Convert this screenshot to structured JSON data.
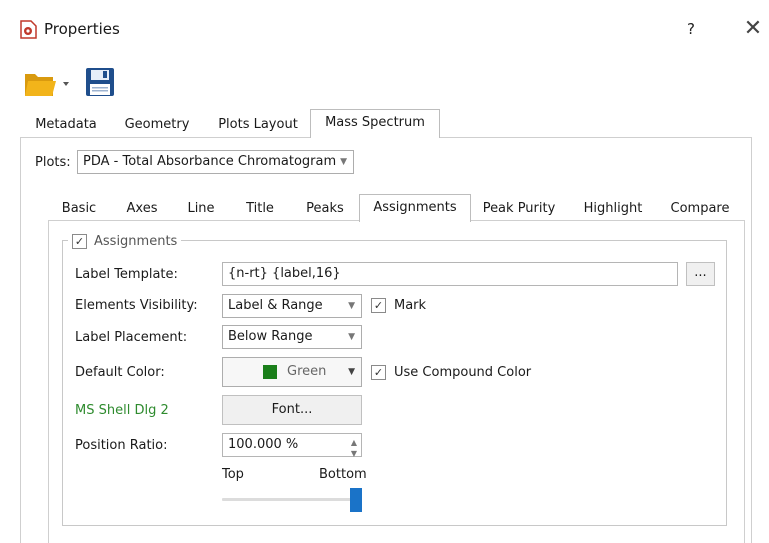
{
  "window": {
    "title": "Properties",
    "help": "?",
    "close": "✕"
  },
  "top_tabs": [
    {
      "label": "Metadata"
    },
    {
      "label": "Geometry"
    },
    {
      "label": "Plots Layout"
    },
    {
      "label": "Mass Spectrum",
      "active": true
    }
  ],
  "plots": {
    "label": "Plots:",
    "value": "PDA - Total Absorbance Chromatogram"
  },
  "sub_tabs": [
    {
      "label": "Basic"
    },
    {
      "label": "Axes"
    },
    {
      "label": "Line"
    },
    {
      "label": "Title"
    },
    {
      "label": "Peaks"
    },
    {
      "label": "Assignments",
      "active": true
    },
    {
      "label": "Peak Purity"
    },
    {
      "label": "Highlight"
    },
    {
      "label": "Compare"
    }
  ],
  "assignments": {
    "group_label": "Assignments",
    "group_checked": true,
    "label_template": {
      "label": "Label Template:",
      "value": "{n-rt} {label,16}",
      "browse": "..."
    },
    "elements_visibility": {
      "label": "Elements Visibility:",
      "value": "Label & Range",
      "mark_label": "Mark",
      "mark_checked": true
    },
    "label_placement": {
      "label": "Label Placement:",
      "value": "Below Range"
    },
    "default_color": {
      "label": "Default Color:",
      "value": "Green",
      "swatch": "#1a7f1a",
      "use_compound_label": "Use Compound Color",
      "use_compound_checked": true
    },
    "font": {
      "name": "MS Shell Dlg 2",
      "name_color": "#2e8b2e",
      "button": "Font..."
    },
    "position_ratio": {
      "label": "Position Ratio:",
      "value": "100.000 %"
    },
    "slider": {
      "min_label": "Top",
      "max_label": "Bottom",
      "value": 1.0
    }
  },
  "colors": {
    "accent": "#1a73c8",
    "folder": "#f2b41a",
    "save": "#1f4e8c"
  }
}
